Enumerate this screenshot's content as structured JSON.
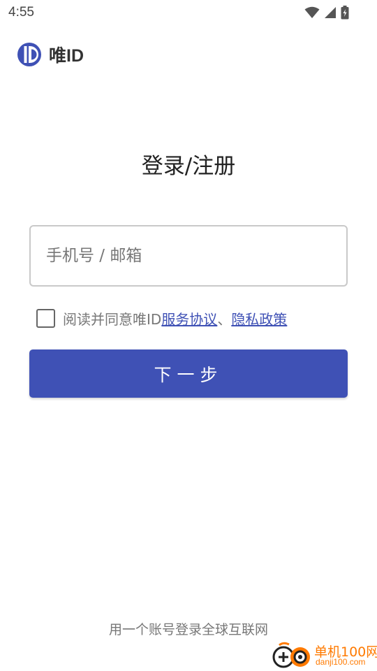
{
  "status_bar": {
    "time": "4:55",
    "icons": [
      "wifi-icon",
      "signal-icon",
      "battery-charging-icon"
    ]
  },
  "brand": {
    "logo_icon": "weiid-logo-icon",
    "name": "唯ID",
    "color": "#3f51b5"
  },
  "login": {
    "title": "登录/注册",
    "input_placeholder": "手机号 / 邮箱",
    "input_value": "",
    "agree_prefix": "阅读并同意唯ID ",
    "terms_link": "服务协议",
    "separator": "、",
    "privacy_link": "隐私政策",
    "agree_checked": false,
    "next_button": "下一步"
  },
  "footer": {
    "slogan": "用一个账号登录全球互联网"
  },
  "watermark": {
    "cn": "单机100网",
    "en": "danji100.com"
  },
  "colors": {
    "accent": "#3f51b5",
    "watermark": "#ff7a00"
  }
}
